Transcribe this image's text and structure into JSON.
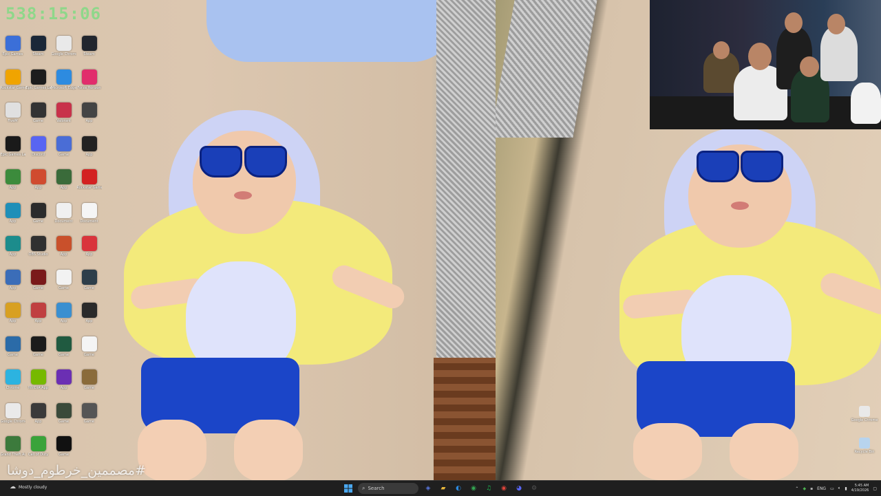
{
  "overlay": {
    "timer": "538:15:06",
    "hashtag": "#مصممين_خرطوم_دوشا"
  },
  "desktop": {
    "icons": [
      {
        "label": "Epic Games",
        "color": "#3b6fd8",
        "icon": "app-icon"
      },
      {
        "label": "Steam",
        "color": "#1b2838",
        "icon": "steam-icon"
      },
      {
        "label": "Google Chrome",
        "color": "#e9e9e9",
        "icon": "chrome-icon"
      },
      {
        "label": "Steam",
        "color": "#22262e",
        "icon": "app-icon"
      },
      {
        "label": "Rockstar Games",
        "color": "#f0a400",
        "icon": "rockstar-icon"
      },
      {
        "label": "Epic Games Launcher",
        "color": "#1d1d1d",
        "icon": "epic-icon"
      },
      {
        "label": "Microsoft Edge",
        "color": "#2d8be0",
        "icon": "edge-icon"
      },
      {
        "label": "Forza Horizon",
        "color": "#e12d6c",
        "icon": "game-icon"
      },
      {
        "label": "FiveM",
        "color": "#e0e0e0",
        "icon": "fivem-icon"
      },
      {
        "label": "Game",
        "color": "#333333",
        "icon": "game-icon"
      },
      {
        "label": "Valorant",
        "color": "#c8324a",
        "icon": "valorant-icon"
      },
      {
        "label": "App",
        "color": "#444444",
        "icon": "app-icon"
      },
      {
        "label": "Epic Games Launcher",
        "color": "#1a1a1a",
        "icon": "epic-icon"
      },
      {
        "label": "Discord",
        "color": "#5865f2",
        "icon": "discord-icon"
      },
      {
        "label": "Game",
        "color": "#4a6dd6",
        "icon": "game-icon"
      },
      {
        "label": "App",
        "color": "#222222",
        "icon": "app-icon"
      },
      {
        "label": "App",
        "color": "#3c8b3c",
        "icon": "app-icon"
      },
      {
        "label": "App",
        "color": "#d04b2f",
        "icon": "app-icon"
      },
      {
        "label": "App",
        "color": "#3a6b3a",
        "icon": "app-icon"
      },
      {
        "label": "Rockstar Games",
        "color": "#d32121",
        "icon": "rockstar-icon"
      },
      {
        "label": "App",
        "color": "#1f8fb8",
        "icon": "app-icon"
      },
      {
        "label": "Game",
        "color": "#2b2b2b",
        "icon": "game-icon"
      },
      {
        "label": "Document",
        "color": "#f0f0f0",
        "icon": "file-icon"
      },
      {
        "label": "Document",
        "color": "#f5f5f5",
        "icon": "file-icon"
      },
      {
        "label": "App",
        "color": "#1c8c8c",
        "icon": "app-icon"
      },
      {
        "label": "OBS Studio",
        "color": "#303030",
        "icon": "obs-icon"
      },
      {
        "label": "App",
        "color": "#c9502b",
        "icon": "app-icon"
      },
      {
        "label": "App",
        "color": "#d9343c",
        "icon": "app-icon"
      },
      {
        "label": "App",
        "color": "#3b6db8",
        "icon": "app-icon"
      },
      {
        "label": "Game",
        "color": "#7a1a1a",
        "icon": "game-icon"
      },
      {
        "label": "Game",
        "color": "#f2f2f2",
        "icon": "game-icon"
      },
      {
        "label": "Game",
        "color": "#2d3e4a",
        "icon": "game-icon"
      },
      {
        "label": "App",
        "color": "#d8a021",
        "icon": "app-icon"
      },
      {
        "label": "App",
        "color": "#c04040",
        "icon": "app-icon"
      },
      {
        "label": "App",
        "color": "#3a8fd0",
        "icon": "app-icon"
      },
      {
        "label": "App",
        "color": "#2a2a2a",
        "icon": "app-icon"
      },
      {
        "label": "Game",
        "color": "#2b6ba8",
        "icon": "game-icon"
      },
      {
        "label": "Game",
        "color": "#1b1b1b",
        "icon": "game-icon"
      },
      {
        "label": "Game",
        "color": "#205a40",
        "icon": "game-icon"
      },
      {
        "label": "Game",
        "color": "#f4f4f4",
        "icon": "game-icon"
      },
      {
        "label": "Chrome",
        "color": "#2cb3e0",
        "icon": "chrome-icon"
      },
      {
        "label": "NVIDIA App",
        "color": "#76b900",
        "icon": "nvidia-icon"
      },
      {
        "label": "App",
        "color": "#6b2fb3",
        "icon": "app-icon"
      },
      {
        "label": "Game",
        "color": "#8a6b3a",
        "icon": "game-icon"
      },
      {
        "label": "Google Chrome",
        "color": "#eaeaea",
        "icon": "chrome-icon"
      },
      {
        "label": "App",
        "color": "#3a3a3a",
        "icon": "app-icon"
      },
      {
        "label": "Game",
        "color": "#3a4a3a",
        "icon": "game-icon"
      },
      {
        "label": "Game",
        "color": "#555555",
        "icon": "game-icon"
      },
      {
        "label": "Grand Theft Auto V",
        "color": "#3c7a3c",
        "icon": "gta-icon"
      },
      {
        "label": "Call of Duty",
        "color": "#3aa33a",
        "icon": "cod-icon"
      },
      {
        "label": "Game",
        "color": "#111111",
        "icon": "game-icon"
      },
      {
        "label": "",
        "color": "transparent",
        "icon": "blank"
      }
    ],
    "right_icons": [
      {
        "label": "Google Chrome",
        "color": "#e9e9e9",
        "icon": "chrome-icon"
      },
      {
        "label": "Recycle Bin",
        "color": "#b8d4ee",
        "icon": "recycle-bin-icon"
      }
    ]
  },
  "taskbar": {
    "weather": "Mostly cloudy",
    "search_placeholder": "Search",
    "language": "ENG",
    "time": "5:45 AM",
    "date": "4/19/2026",
    "pinned": [
      {
        "name": "copilot-icon",
        "color": "#5a78e0",
        "glyph": "◈"
      },
      {
        "name": "file-explorer-icon",
        "color": "#e8b73a",
        "glyph": "▰"
      },
      {
        "name": "edge-icon",
        "color": "#2d8be0",
        "glyph": "◐"
      },
      {
        "name": "chrome-icon",
        "color": "#34a853",
        "glyph": "◉"
      },
      {
        "name": "spotify-icon",
        "color": "#1db954",
        "glyph": "♫"
      },
      {
        "name": "chrome-icon-2",
        "color": "#e0443a",
        "glyph": "◉"
      },
      {
        "name": "discord-icon",
        "color": "#5865f2",
        "glyph": "◕"
      },
      {
        "name": "settings-icon",
        "color": "#555555",
        "glyph": "⚙"
      }
    ]
  }
}
